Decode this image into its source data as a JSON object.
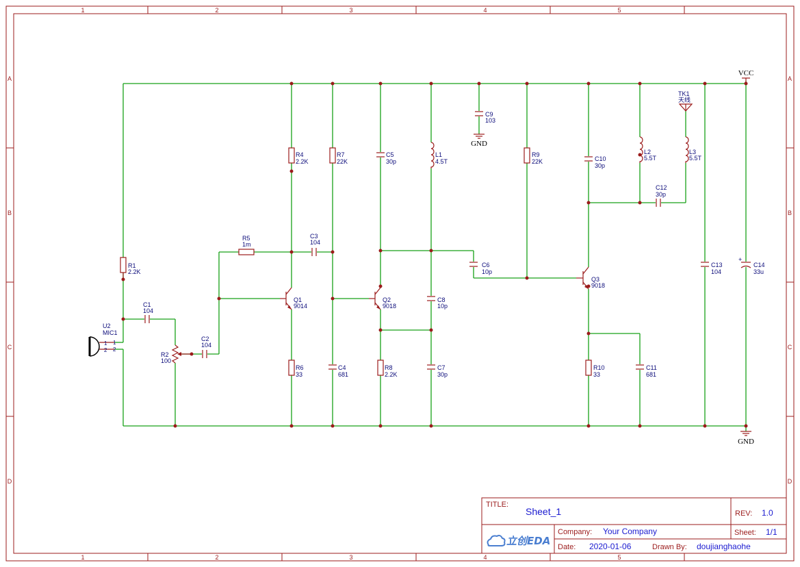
{
  "sheet": {
    "columns": [
      "1",
      "2",
      "3",
      "4",
      "5"
    ],
    "rows": [
      "A",
      "B",
      "C",
      "D"
    ]
  },
  "nets": {
    "vcc": "VCC",
    "gnd_top": "GND",
    "gnd_bottom": "GND"
  },
  "components": {
    "U2": {
      "ref": "U2",
      "value": "MIC1",
      "pin1": "1",
      "pin2": "2"
    },
    "R1": {
      "ref": "R1",
      "value": "2.2K"
    },
    "C1": {
      "ref": "C1",
      "value": "104"
    },
    "R2": {
      "ref": "R2",
      "value": "100"
    },
    "C2": {
      "ref": "C2",
      "value": "104"
    },
    "R5": {
      "ref": "R5",
      "value": "1m"
    },
    "C3": {
      "ref": "C3",
      "value": "104"
    },
    "R4": {
      "ref": "R4",
      "value": "2.2K"
    },
    "Q1": {
      "ref": "Q1",
      "value": "9014"
    },
    "R6": {
      "ref": "R6",
      "value": "33"
    },
    "R7": {
      "ref": "R7",
      "value": "22K"
    },
    "C4": {
      "ref": "C4",
      "value": "681"
    },
    "C5": {
      "ref": "C5",
      "value": "30p"
    },
    "Q2": {
      "ref": "Q2",
      "value": "9018"
    },
    "R8": {
      "ref": "R8",
      "value": "2.2K"
    },
    "L1": {
      "ref": "L1",
      "value": "4.5T"
    },
    "C8": {
      "ref": "C8",
      "value": "10p"
    },
    "C7": {
      "ref": "C7",
      "value": "30p"
    },
    "C9": {
      "ref": "C9",
      "value": "103"
    },
    "C6": {
      "ref": "C6",
      "value": "10p"
    },
    "R9": {
      "ref": "R9",
      "value": "22K"
    },
    "C10": {
      "ref": "C10",
      "value": "30p"
    },
    "Q3": {
      "ref": "Q3",
      "value": "9018"
    },
    "R10": {
      "ref": "R10",
      "value": "33"
    },
    "C11": {
      "ref": "C11",
      "value": "681"
    },
    "L2": {
      "ref": "L2",
      "value": "5.5T"
    },
    "L3": {
      "ref": "L3",
      "value": "5.5T"
    },
    "C12": {
      "ref": "C12",
      "value": "30p"
    },
    "TK1": {
      "ref": "TK1",
      "value": "天线"
    },
    "C13": {
      "ref": "C13",
      "value": "104"
    },
    "C14": {
      "ref": "C14",
      "value": "33u",
      "polarity": "+"
    }
  },
  "title_block": {
    "title_label": "TITLE:",
    "title": "Sheet_1",
    "rev_label": "REV:",
    "rev": "1.0",
    "logo": "立创EDA",
    "company_label": "Company:",
    "company": "Your Company",
    "sheet_label": "Sheet:",
    "sheet": "1/1",
    "date_label": "Date:",
    "date": "2020-01-06",
    "drawn_by_label": "Drawn By:",
    "drawn_by": "doujianghaohe"
  },
  "colors": {
    "frame": "#9b1b1b",
    "wire": "#17a017",
    "designator": "#0b0b7a",
    "title_value": "#1a1ad0",
    "logo": "#4a7ed0"
  }
}
